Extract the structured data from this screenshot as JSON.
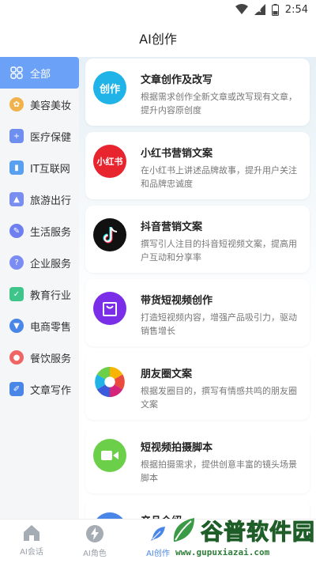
{
  "status_bar": {
    "time": "2:54"
  },
  "header": {
    "title": "AI创作"
  },
  "sidebar": {
    "items": [
      {
        "label": "全部",
        "icon": "grid-icon",
        "color": "#ffffff"
      },
      {
        "label": "美容美妆",
        "icon": "beauty-icon",
        "color": "#f0b24a"
      },
      {
        "label": "医疗保健",
        "icon": "medical-icon",
        "color": "#6e8ef0"
      },
      {
        "label": "IT互联网",
        "icon": "it-icon",
        "color": "#5aa0f0"
      },
      {
        "label": "旅游出行",
        "icon": "travel-icon",
        "color": "#7a8ef0"
      },
      {
        "label": "生活服务",
        "icon": "life-icon",
        "color": "#6e7ff0"
      },
      {
        "label": "企业服务",
        "icon": "enterprise-icon",
        "color": "#7b8cf5"
      },
      {
        "label": "教育行业",
        "icon": "education-icon",
        "color": "#3fc48a"
      },
      {
        "label": "电商零售",
        "icon": "ecommerce-icon",
        "color": "#4a86e8"
      },
      {
        "label": "餐饮服务",
        "icon": "catering-icon",
        "color": "#f06464"
      },
      {
        "label": "文章写作",
        "icon": "writing-icon",
        "color": "#4a86e8"
      }
    ]
  },
  "cards": [
    {
      "title": "文章创作及改写",
      "desc": "根据需求创作全新文章或改写现有文章，提升内容原创度",
      "icon_text": "创作",
      "icon": "article-icon",
      "color": "#1fb3e8"
    },
    {
      "title": "小红书营销文案",
      "desc": "在小红书上讲述品牌故事，提升用户关注和品牌忠诚度",
      "icon_text": "小红书",
      "icon": "xiaohongshu-icon",
      "color": "#e8242f"
    },
    {
      "title": "抖音营销文案",
      "desc": "撰写引人注目的抖音短视频文案，提高用户互动和分享率",
      "icon_text": "",
      "icon": "douyin-icon",
      "color": "#111111"
    },
    {
      "title": "带货短视频创作",
      "desc": "打造短视频内容，增强产品吸引力，驱动销售增长",
      "icon_text": "",
      "icon": "shopping-bag-icon",
      "color": "#7a2ee8"
    },
    {
      "title": "朋友圈文案",
      "desc": "根据发圈目的，撰写有情感共鸣的朋友圈文案",
      "icon_text": "",
      "icon": "aperture-icon",
      "color": "#ffffff"
    },
    {
      "title": "短视频拍摄脚本",
      "desc": "根据拍摄需求，提供创意丰富的镜头场景脚本",
      "icon_text": "",
      "icon": "video-camera-icon",
      "color": "#6ccf4a"
    },
    {
      "title": "产品介绍",
      "desc": "",
      "icon_text": "",
      "icon": "product-icon",
      "color": "#4a86e8"
    }
  ],
  "bottom_nav": [
    {
      "label": "AI会话",
      "icon": "home-icon"
    },
    {
      "label": "AI角色",
      "icon": "lightning-icon"
    },
    {
      "label": "AI创作",
      "icon": "feather-icon"
    }
  ],
  "watermark": {
    "text": "谷普软件园",
    "url": "www.gupuxiazai.com"
  }
}
